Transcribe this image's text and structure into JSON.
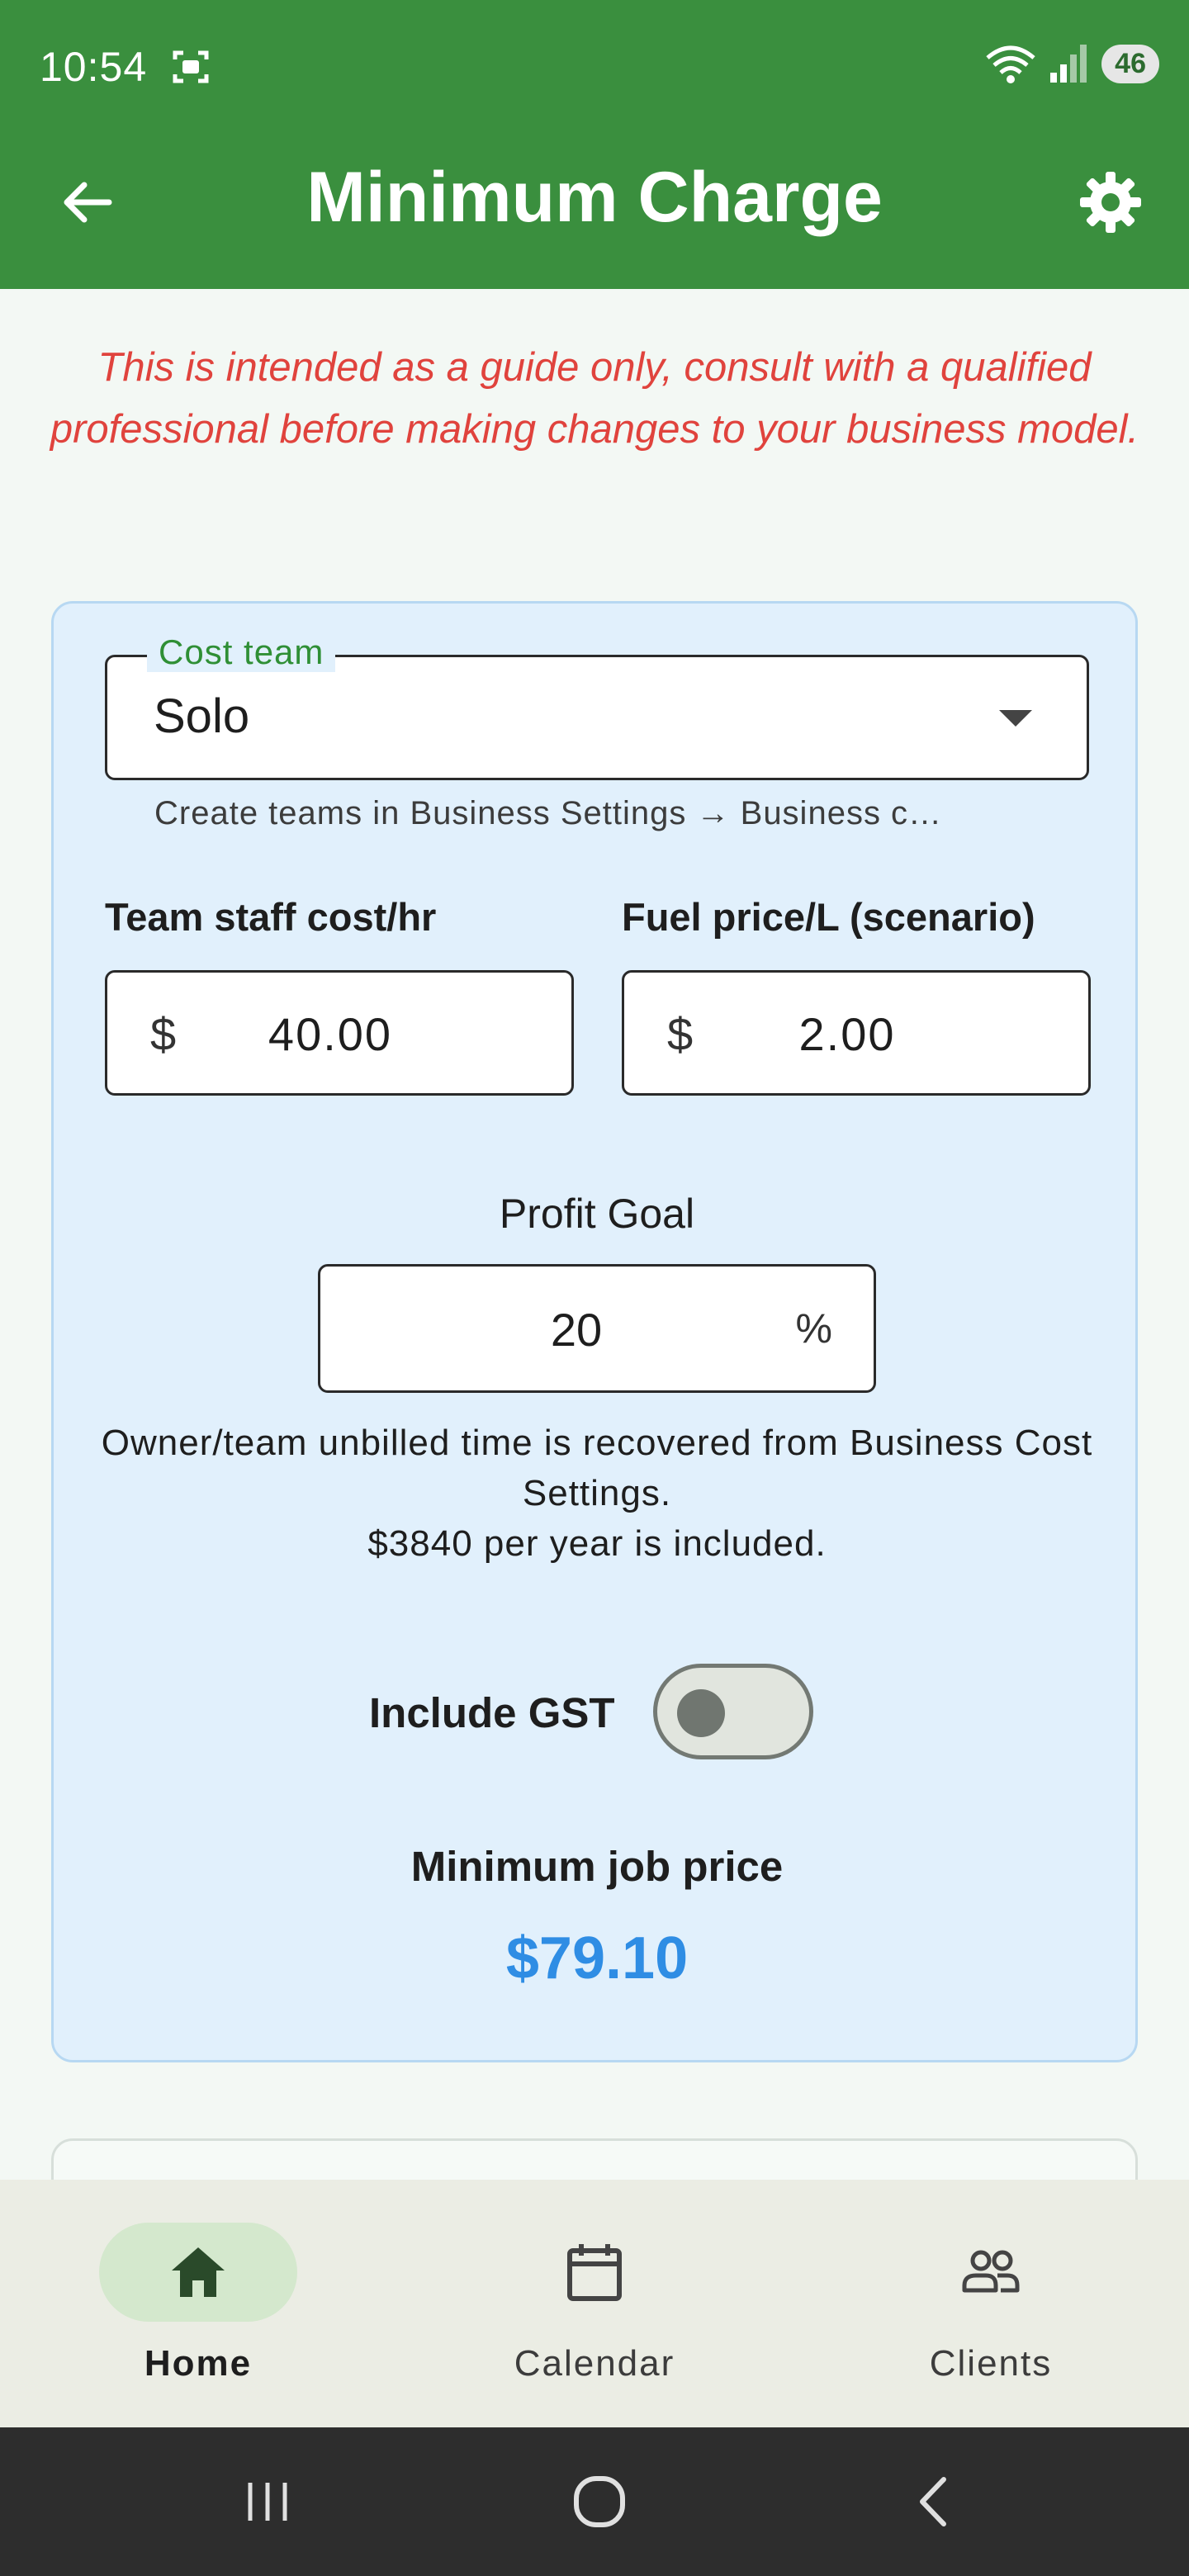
{
  "status_bar": {
    "time": "10:54",
    "battery": "46"
  },
  "app_bar": {
    "title": "Minimum Charge"
  },
  "disclaimer": "This is intended as a guide only, consult with a qualified professional before making changes to your business model.",
  "form": {
    "cost_team": {
      "label": "Cost team",
      "value": "Solo",
      "helper": "Create teams in Business Settings → Business c…"
    },
    "staff_cost": {
      "label": "Team staff cost/hr",
      "prefix": "$",
      "value": "40.00"
    },
    "fuel_price": {
      "label": "Fuel price/L (scenario)",
      "prefix": "$",
      "value": "2.00"
    },
    "profit_goal": {
      "label": "Profit Goal",
      "value": "20",
      "suffix": "%"
    },
    "info_line1": "Owner/team unbilled time is recovered from Business Cost Settings.",
    "info_line2": "$3840 per year is included.",
    "gst": {
      "label": "Include GST",
      "on": false
    },
    "result": {
      "label": "Minimum job price",
      "value": "$79.10"
    }
  },
  "bottom_nav": {
    "items": [
      {
        "label": "Home",
        "icon": "home-icon",
        "active": true
      },
      {
        "label": "Calendar",
        "icon": "calendar-icon",
        "active": false
      },
      {
        "label": "Clients",
        "icon": "clients-icon",
        "active": false
      }
    ]
  },
  "colors": {
    "primary": "#3a8f3e",
    "warning_text": "#e0433d",
    "result_text": "#2f8de4",
    "card_bg": "#e1f0fc"
  }
}
